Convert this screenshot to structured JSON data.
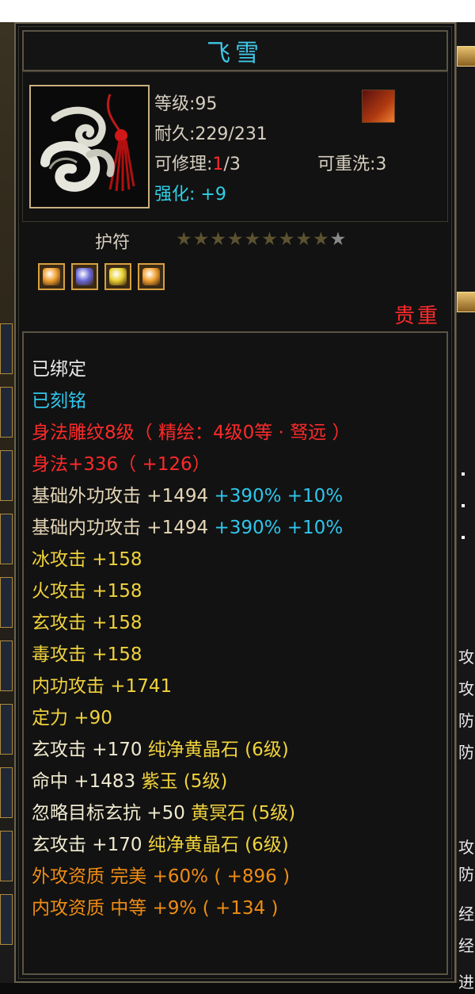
{
  "item": {
    "name": "飞雪",
    "level_label": "等级:95",
    "durability_label": "耐久:229/231",
    "repair_prefix": "可修理:",
    "repair_current": "1",
    "repair_suffix": "/3",
    "rewash_label": "可重洗:3",
    "enhance_label": "强化: +9",
    "type_label": "护符",
    "stars_filled": 9,
    "stars_total": 10,
    "rarity": "贵重"
  },
  "gems": [
    {
      "name": "orange-socket-gem",
      "color": "#f0a030"
    },
    {
      "name": "blue-socket-gem",
      "color": "#6a6ad8"
    },
    {
      "name": "yellow-socket-gem",
      "color": "#e8d030"
    },
    {
      "name": "orange-socket-gem-2",
      "color": "#f0a030"
    }
  ],
  "attributes": [
    {
      "text": "已绑定",
      "color": "white"
    },
    {
      "text": "已刻铭",
      "color": "cyan"
    },
    {
      "text": "身法雕纹8级（ 精绘：4级0等 · 驽远 ）",
      "color": "red"
    },
    {
      "text": "身法+336（ +126）",
      "color": "red"
    },
    {
      "parts": [
        {
          "text": "基础外功攻击  +1494  ",
          "color": "beige"
        },
        {
          "text": "+390% +10%",
          "color": "cyan"
        }
      ]
    },
    {
      "parts": [
        {
          "text": "基础内功攻击  +1494  ",
          "color": "beige"
        },
        {
          "text": "+390% +10%",
          "color": "cyan"
        }
      ]
    },
    {
      "text": "冰攻击  +158",
      "color": "yellow"
    },
    {
      "text": "火攻击  +158",
      "color": "yellow"
    },
    {
      "text": "玄攻击  +158",
      "color": "yellow"
    },
    {
      "text": "毒攻击  +158",
      "color": "yellow"
    },
    {
      "text": "内功攻击  +1741",
      "color": "yellow"
    },
    {
      "text": "定力  +90",
      "color": "yellow"
    },
    {
      "parts": [
        {
          "text": "玄攻击  +170  ",
          "color": "light"
        },
        {
          "text": "纯净黄晶石 (6级)",
          "color": "yellow"
        }
      ]
    },
    {
      "parts": [
        {
          "text": "命中  +1483  ",
          "color": "light"
        },
        {
          "text": "紫玉 (5级)",
          "color": "yellow"
        }
      ]
    },
    {
      "parts": [
        {
          "text": "忽略目标玄抗  +50  ",
          "color": "light"
        },
        {
          "text": "黄冥石 (5级)",
          "color": "yellow"
        }
      ]
    },
    {
      "parts": [
        {
          "text": "玄攻击  +170  ",
          "color": "light"
        },
        {
          "text": "纯净黄晶石 (6级)",
          "color": "yellow"
        }
      ]
    },
    {
      "text": "外攻资质    完美  +60%  ( +896 )",
      "color": "orange"
    },
    {
      "text": "内攻资质    中等  +9%  ( +134 )",
      "color": "orange"
    }
  ],
  "side_right": [
    "攻",
    "攻",
    "防",
    "防",
    "攻",
    "防",
    "经",
    "经",
    "进"
  ],
  "colors": {
    "title": "#3fc6e6",
    "red": "#ff2a2a",
    "cyan": "#2fc6ec",
    "yellow": "#f0d23c",
    "orange": "#f08c14",
    "beige": "#e6d6b8"
  }
}
